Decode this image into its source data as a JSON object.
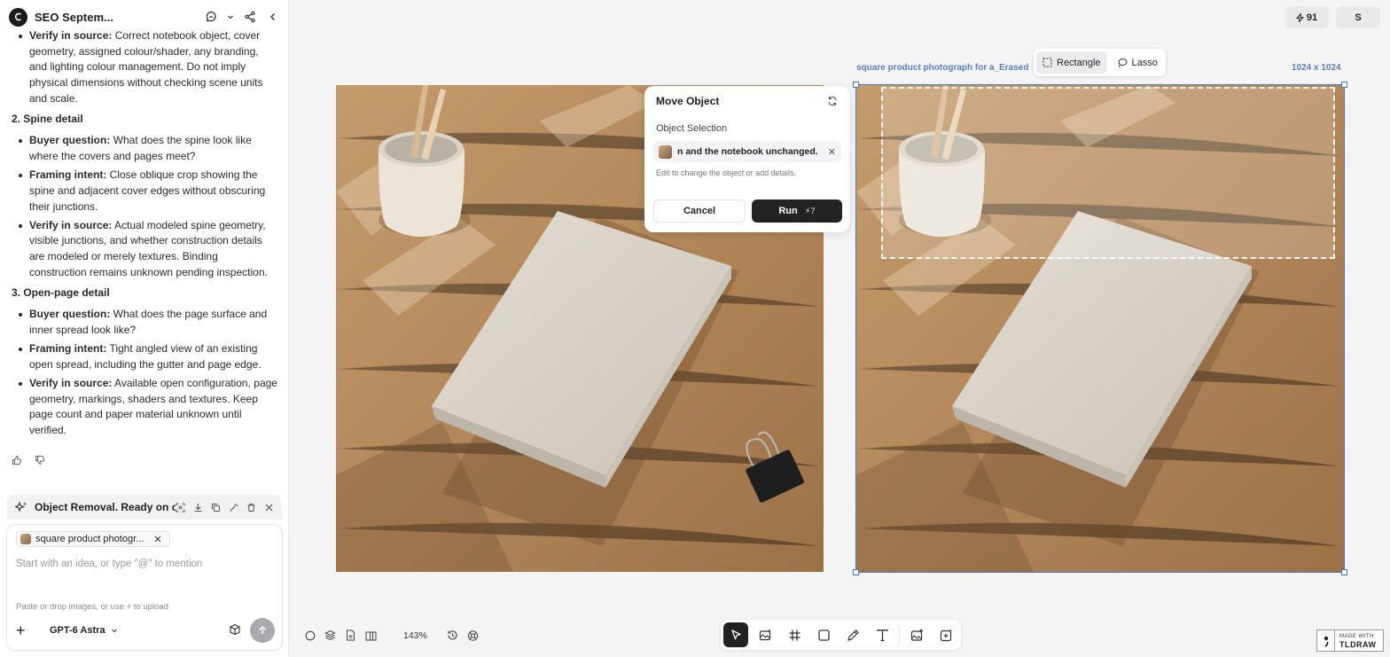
{
  "header": {
    "project_title": "SEO Septem..."
  },
  "chat": {
    "intro_item": {
      "label": "Verify in source:",
      "text": " Correct notebook object, cover geometry, assigned colour/shader, any branding, and lighting colour management. Do not imply physical dimensions without checking scene units and scale."
    },
    "sections": [
      {
        "heading": "2. Spine detail",
        "items": [
          {
            "label": "Buyer question:",
            "text": " What does the spine look like where the covers and pages meet?"
          },
          {
            "label": "Framing intent:",
            "text": " Close oblique crop showing the spine and adjacent cover edges without obscuring their junctions."
          },
          {
            "label": "Verify in source:",
            "text": " Actual modeled spine geometry, visible junctions, and whether construction details are modeled or merely textures. Binding construction remains unknown pending inspection."
          }
        ]
      },
      {
        "heading": "3. Open-page detail",
        "items": [
          {
            "label": "Buyer question:",
            "text": " What does the page surface and inner spread look like?"
          },
          {
            "label": "Framing intent:",
            "text": " Tight angled view of an existing open spread, including the gutter and page edge."
          },
          {
            "label": "Verify in source:",
            "text": " Available open configuration, page geometry, markings, shaders and textures. Keep page count and paper material unknown until verified."
          }
        ]
      }
    ]
  },
  "task": {
    "title": "Object Removal. Ready on c..."
  },
  "composer": {
    "chip_label": "square product photogr...",
    "placeholder": "Start with an idea, or type \"@\" to mention",
    "upload_hint": "Paste or drop images, or use + to upload",
    "model": "GPT-6 Astra"
  },
  "top_right": {
    "credits": "91",
    "user_initial": "S"
  },
  "canvas": {
    "image_label": "square product photograph for a_Erased",
    "image_size": "1024 x 1024",
    "modes": [
      {
        "label": "Rectangle",
        "active": true
      },
      {
        "label": "Lasso",
        "active": false
      }
    ],
    "zoom": "143%"
  },
  "move_panel": {
    "title": "Move Object",
    "selection_label": "Object Selection",
    "selection_value": "n and the notebook unchanged.",
    "help_text": "Edit to change the object or add details.",
    "cancel_label": "Cancel",
    "run_label": "Run",
    "run_cost": "7"
  },
  "toolbar": {
    "tools": [
      "select-tool",
      "image-generate-tool",
      "frame-tool",
      "rectangle-tool",
      "pencil-tool",
      "text-tool",
      "image-edit-tool",
      "ai-tool"
    ]
  },
  "watermark": {
    "line1": "MADE WITH",
    "line2": "TLDRAW"
  },
  "colors": {
    "accent": "#4a78c9",
    "dark_button": "#222222",
    "wood": "#b58a5a"
  }
}
